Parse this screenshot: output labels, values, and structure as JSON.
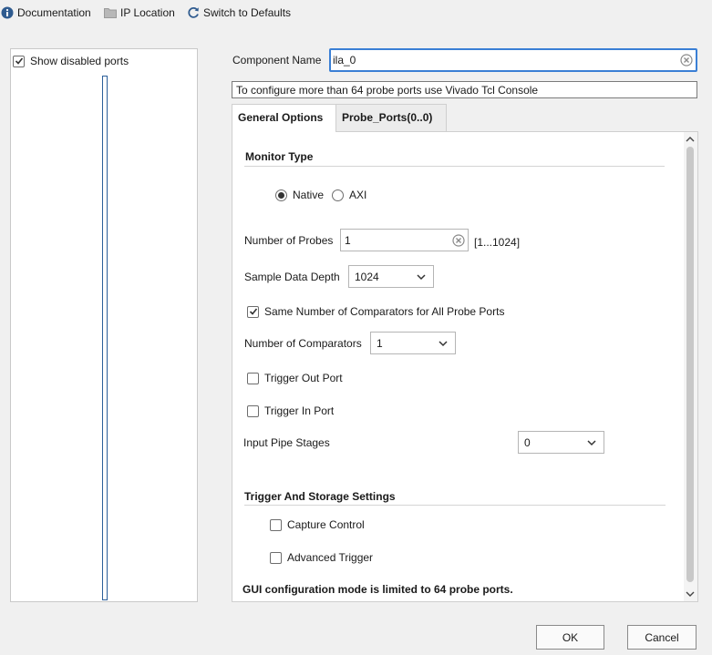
{
  "toolbar": {
    "documentation": "Documentation",
    "ip_location": "IP Location",
    "switch_defaults": "Switch to Defaults"
  },
  "left_panel": {
    "show_disabled_ports": "Show disabled ports",
    "show_disabled_checked": true
  },
  "component": {
    "label": "Component Name",
    "value": "ila_0"
  },
  "info_text": "To configure more than 64 probe ports use Vivado Tcl Console",
  "tabs": [
    {
      "label": "General Options",
      "active": true
    },
    {
      "label": "Probe_Ports(0..0)",
      "active": false
    }
  ],
  "general": {
    "monitor_type_title": "Monitor Type",
    "monitor_options": [
      {
        "label": "Native",
        "selected": true
      },
      {
        "label": "AXI",
        "selected": false
      }
    ],
    "num_probes_label": "Number of Probes",
    "num_probes_value": "1",
    "num_probes_range": "[1...1024]",
    "sample_depth_label": "Sample Data Depth",
    "sample_depth_value": "1024",
    "same_comparators_label": "Same Number of Comparators for All Probe Ports",
    "same_comparators_checked": true,
    "num_comparators_label": "Number of Comparators",
    "num_comparators_value": "1",
    "trigger_out_label": "Trigger Out Port",
    "trigger_out_checked": false,
    "trigger_in_label": "Trigger In Port",
    "trigger_in_checked": false,
    "input_pipe_label": "Input Pipe Stages",
    "input_pipe_value": "0",
    "trigger_storage_title": "Trigger And Storage Settings",
    "capture_control_label": "Capture Control",
    "capture_control_checked": false,
    "advanced_trigger_label": "Advanced Trigger",
    "advanced_trigger_checked": false,
    "footer_note": "GUI configuration mode is limited to 64 probe ports."
  },
  "buttons": {
    "ok": "OK",
    "cancel": "Cancel"
  },
  "colors": {
    "accent": "#3a7fd5",
    "info_icon": "#2f5b8f"
  },
  "icons": {
    "documentation": "info-icon",
    "ip_location": "folder-icon",
    "switch_defaults": "refresh-icon",
    "clear": "clear-icon",
    "dropdown": "chevron-down-icon"
  }
}
